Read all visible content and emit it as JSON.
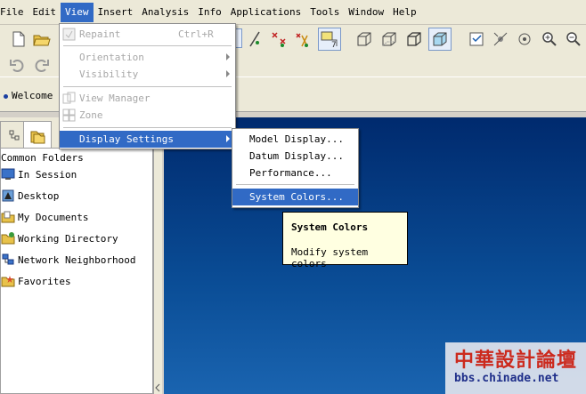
{
  "menubar": {
    "items": [
      {
        "label": "File"
      },
      {
        "label": "Edit"
      },
      {
        "label": "View"
      },
      {
        "label": "Insert"
      },
      {
        "label": "Analysis"
      },
      {
        "label": "Info"
      },
      {
        "label": "Applications"
      },
      {
        "label": "Tools"
      },
      {
        "label": "Window"
      },
      {
        "label": "Help"
      }
    ]
  },
  "message": {
    "text": "Welcome t"
  },
  "view_menu": {
    "items": [
      {
        "label": "Repaint",
        "shortcut": "Ctrl+R",
        "enabled": false
      },
      {
        "label": "Orientation",
        "enabled": false,
        "submenu": true
      },
      {
        "label": "Visibility",
        "enabled": false,
        "submenu": true
      },
      {
        "label": "View Manager",
        "enabled": false
      },
      {
        "label": "Zone",
        "enabled": false
      },
      {
        "label": "Display Settings",
        "enabled": true,
        "submenu": true,
        "highlighted": true
      }
    ]
  },
  "display_settings_menu": {
    "items": [
      {
        "label": "Model Display..."
      },
      {
        "label": "Datum Display..."
      },
      {
        "label": "Performance..."
      },
      {
        "label": "System Colors...",
        "highlighted": true
      }
    ]
  },
  "tooltip": {
    "title": "System Colors",
    "body": "Modify system colors"
  },
  "navigator": {
    "header": "Common Folders",
    "items": [
      {
        "label": "In Session",
        "icon": "monitor-icon"
      },
      {
        "label": "Desktop",
        "icon": "desktop-icon"
      },
      {
        "label": "My Documents",
        "icon": "documents-folder-icon"
      },
      {
        "label": "Working Directory",
        "icon": "working-folder-icon"
      },
      {
        "label": "Network Neighborhood",
        "icon": "network-icon"
      },
      {
        "label": "Favorites",
        "icon": "favorites-icon"
      }
    ]
  },
  "watermark": {
    "title": "中華設計論壇",
    "url": "bbs.chinade.net"
  },
  "colors": {
    "menu_highlight": "#316ac5",
    "graphics_top": "#002a6e",
    "graphics_bottom": "#1a64b0",
    "tooltip_bg": "#ffffe1",
    "watermark_title": "#cc2a1e",
    "watermark_url": "#1f2f8a"
  }
}
